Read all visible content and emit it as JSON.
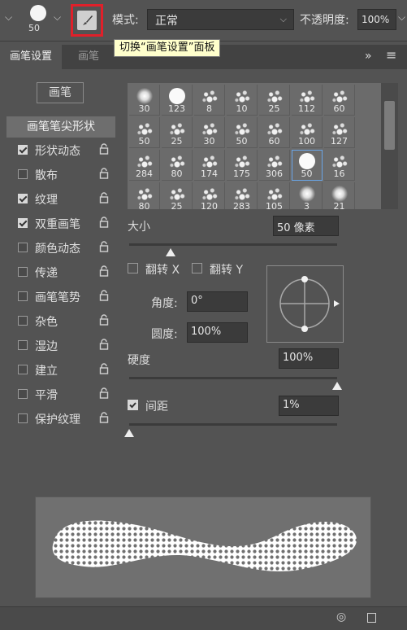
{
  "topbar": {
    "brush_size": "50",
    "mode_label": "模式:",
    "mode_value": "正常",
    "opacity_label": "不透明度:",
    "opacity_value": "100%",
    "tooltip": "切换“画笔设置”面板"
  },
  "tabs": [
    {
      "label": "画笔设置",
      "active": true
    },
    {
      "label": "画笔",
      "active": false
    }
  ],
  "left": {
    "brushes_button": "画笔",
    "tip_shape": "画笔笔尖形状",
    "options": [
      {
        "label": "形状动态",
        "checked": true
      },
      {
        "label": "散布",
        "checked": false
      },
      {
        "label": "纹理",
        "checked": true
      },
      {
        "label": "双重画笔",
        "checked": true
      },
      {
        "label": "颜色动态",
        "checked": false
      },
      {
        "label": "传递",
        "checked": false
      },
      {
        "label": "画笔笔势",
        "checked": false
      },
      {
        "label": "杂色",
        "checked": false
      },
      {
        "label": "湿边",
        "checked": false
      },
      {
        "label": "建立",
        "checked": false
      },
      {
        "label": "平滑",
        "checked": false
      },
      {
        "label": "保护纹理",
        "checked": false
      }
    ]
  },
  "brush_grid": {
    "sizes": [
      "30",
      "123",
      "8",
      "10",
      "25",
      "112",
      "60",
      "50",
      "25",
      "30",
      "50",
      "60",
      "100",
      "127",
      "284",
      "80",
      "174",
      "175",
      "306",
      "50",
      "16",
      "80",
      "25",
      "120",
      "283",
      "105",
      "3",
      "21"
    ],
    "selected_index": 19
  },
  "settings": {
    "size_label": "大小",
    "size_value": "50 像素",
    "flip_x": "翻转 X",
    "flip_y": "翻转 Y",
    "angle_label": "角度:",
    "angle_value": "0°",
    "roundness_label": "圆度:",
    "roundness_value": "100%",
    "hardness_label": "硬度",
    "hardness_value": "100%",
    "spacing_label": "间距",
    "spacing_value": "1%",
    "spacing_checked": true,
    "size_level": 0.2,
    "hardness_level": 1.0,
    "spacing_level": 0.0
  },
  "colors": {
    "highlight": "#e0202a",
    "tooltip_bg": "#ffffcc",
    "selection": "#6aa6e8"
  }
}
